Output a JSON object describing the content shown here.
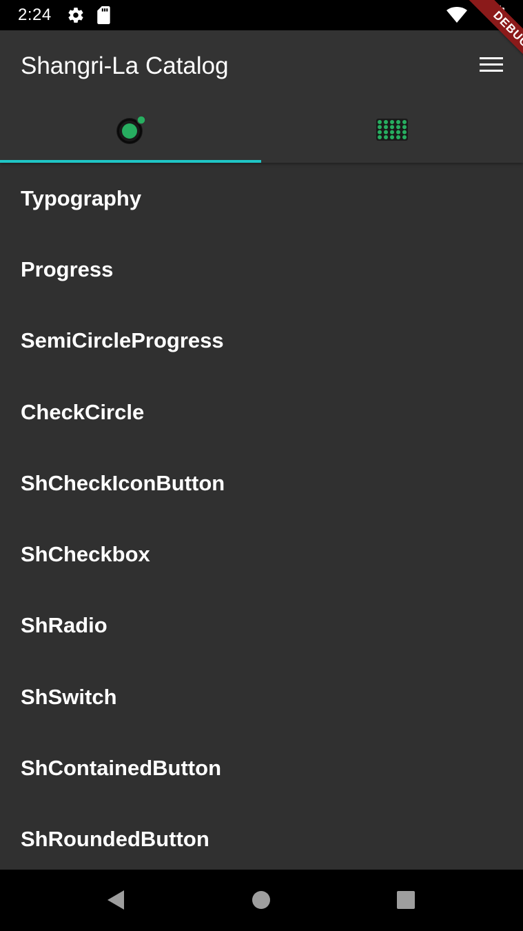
{
  "status_bar": {
    "time": "2:24",
    "icons": [
      "gear-icon",
      "sd-card-icon",
      "wifi-icon",
      "battery-icon"
    ]
  },
  "debug_banner": {
    "label": "DEBUG"
  },
  "app_bar": {
    "title": "Shangri-La Catalog",
    "menu_icon": "hamburger-menu-icon",
    "tabs": [
      {
        "icon": "radio-dot-icon",
        "selected": true
      },
      {
        "icon": "grid-dots-icon",
        "selected": false
      }
    ]
  },
  "list": {
    "items": [
      "Typography",
      "Progress",
      "SemiCircleProgress",
      "CheckCircle",
      "ShCheckIconButton",
      "ShCheckbox",
      "ShRadio",
      "ShSwitch",
      "ShContainedButton",
      "ShRoundedButton"
    ]
  },
  "nav_bar": {
    "icons": [
      "back-icon",
      "home-icon",
      "recents-icon"
    ]
  },
  "colors": {
    "background": "#303030",
    "app_bar": "#333333",
    "indicator": "#1fc6c6",
    "accent_green": "#27ae60",
    "debug_ribbon": "#8b1a1a"
  }
}
